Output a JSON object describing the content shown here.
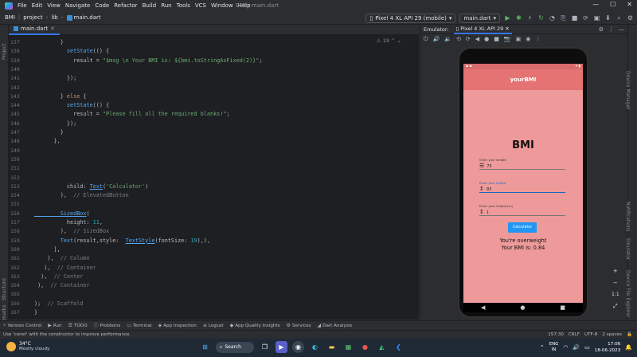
{
  "menubar": {
    "items": [
      "File",
      "Edit",
      "View",
      "Navigate",
      "Code",
      "Refactor",
      "Build",
      "Run",
      "Tools",
      "VCS",
      "Window",
      "Help"
    ],
    "window_title": "BMI - main.dart"
  },
  "navbar": {
    "crumbs": [
      "BMI",
      "project",
      "lib",
      "main.dart"
    ]
  },
  "toolbar": {
    "device": "Pixel 4 XL API 29 (mobile)",
    "run_config": "main.dart"
  },
  "editor": {
    "tab": "main.dart",
    "warnings": "19",
    "lines": [
      {
        "n": "137",
        "t": [
          {
            "c": "cls",
            "v": "        }"
          }
        ]
      },
      {
        "n": "138",
        "t": [
          {
            "c": "fn",
            "v": "          setState"
          },
          {
            "c": "cls",
            "v": "(() {"
          }
        ]
      },
      {
        "n": "139",
        "t": [
          {
            "c": "cls",
            "v": "            result = "
          },
          {
            "c": "str",
            "v": "\"$msg \\n Your BMI is: ${bmi.toStringAsFixed(2)}\""
          },
          {
            "c": "cls",
            "v": ";"
          }
        ]
      },
      {
        "n": "140",
        "t": []
      },
      {
        "n": "141",
        "t": [
          {
            "c": "cls",
            "v": "          });"
          }
        ]
      },
      {
        "n": "142",
        "t": []
      },
      {
        "n": "143",
        "t": [
          {
            "c": "cls",
            "v": "        } "
          },
          {
            "c": "kw",
            "v": "else"
          },
          {
            "c": "cls",
            "v": " {"
          }
        ]
      },
      {
        "n": "144",
        "t": [
          {
            "c": "fn",
            "v": "          setState"
          },
          {
            "c": "cls",
            "v": "(() {"
          }
        ]
      },
      {
        "n": "145",
        "t": [
          {
            "c": "cls",
            "v": "            result = "
          },
          {
            "c": "str",
            "v": "\"Please fill all the required blanks!\""
          },
          {
            "c": "cls",
            "v": ";"
          }
        ]
      },
      {
        "n": "146",
        "t": [
          {
            "c": "cls",
            "v": "          });"
          }
        ]
      },
      {
        "n": "147",
        "t": [
          {
            "c": "cls",
            "v": "        }"
          }
        ]
      },
      {
        "n": "148",
        "t": [
          {
            "c": "cls",
            "v": "      },"
          }
        ]
      },
      {
        "n": "149",
        "t": []
      },
      {
        "n": "150",
        "t": []
      },
      {
        "n": "151",
        "t": []
      },
      {
        "n": "152",
        "t": []
      },
      {
        "n": "153",
        "t": [
          {
            "c": "cls",
            "v": "          child: "
          },
          {
            "c": "lnk",
            "v": "Text"
          },
          {
            "c": "cls",
            "v": "("
          },
          {
            "c": "str",
            "v": "'Calculator'"
          },
          {
            "c": "cls",
            "v": ")"
          }
        ]
      },
      {
        "n": "154",
        "t": [
          {
            "c": "cls",
            "v": "        ),  "
          },
          {
            "c": "cm",
            "v": "// ElevatedButton"
          }
        ]
      },
      {
        "n": "155",
        "t": []
      },
      {
        "n": "156",
        "t": [
          {
            "c": "lnk",
            "v": "        SizedBox"
          },
          {
            "c": "cls",
            "v": "("
          }
        ]
      },
      {
        "n": "157",
        "t": [
          {
            "c": "cls",
            "v": "          height: "
          },
          {
            "c": "num",
            "v": "11"
          },
          {
            "c": "cls",
            "v": ","
          }
        ]
      },
      {
        "n": "158",
        "t": [
          {
            "c": "cls",
            "v": "        ),  "
          },
          {
            "c": "cm",
            "v": "// SizedBox"
          }
        ]
      },
      {
        "n": "159",
        "t": [
          {
            "c": "fn",
            "v": "        Text"
          },
          {
            "c": "cls",
            "v": "(result,style:  "
          },
          {
            "c": "lnk",
            "v": "TextStyle"
          },
          {
            "c": "cls",
            "v": "(fontSize: "
          },
          {
            "c": "num",
            "v": "19"
          },
          {
            "c": "cls",
            "v": "),),"
          }
        ]
      },
      {
        "n": "160",
        "t": [
          {
            "c": "cls",
            "v": "      ],"
          }
        ]
      },
      {
        "n": "161",
        "t": [
          {
            "c": "cls",
            "v": "    ),  "
          },
          {
            "c": "cm",
            "v": "// Column"
          }
        ]
      },
      {
        "n": "162",
        "t": [
          {
            "c": "cls",
            "v": "   ),  "
          },
          {
            "c": "cm",
            "v": "// Container"
          }
        ]
      },
      {
        "n": "163",
        "t": [
          {
            "c": "cls",
            "v": "  ),  "
          },
          {
            "c": "cm",
            "v": "// Center"
          }
        ]
      },
      {
        "n": "164",
        "t": [
          {
            "c": "cls",
            "v": " ),  "
          },
          {
            "c": "cm",
            "v": "// Container"
          }
        ]
      },
      {
        "n": "165",
        "t": []
      },
      {
        "n": "166",
        "t": [
          {
            "c": "cls",
            "v": ");  "
          },
          {
            "c": "cm",
            "v": "// Scaffold"
          }
        ]
      },
      {
        "n": "167",
        "t": [
          {
            "c": "cls",
            "v": "}"
          }
        ]
      }
    ]
  },
  "emulator": {
    "label": "Emulator:",
    "tab": "Pixel 4 XL API 29"
  },
  "app": {
    "appbar_title": "yourBMI",
    "heading": "BMI",
    "weight_label": "Enter your weight",
    "weight_value": "75",
    "height_label": "Enter your height",
    "height_value": "93",
    "hr_label": "Enter your height(cm)",
    "hr_value": "1",
    "button": "Calculator",
    "result_line1": "You're overweight",
    "result_line2": "Your BMI is: 0.84"
  },
  "right_strip": [
    "Device Manager",
    "Notifications",
    "Emulator",
    "Device File Explorer"
  ],
  "left_strip": [
    "Project",
    "Structure",
    "Bookmarks"
  ],
  "bottom_tools": [
    "Version Control",
    "Run",
    "TODO",
    "Problems",
    "Terminal",
    "App Inspection",
    "Logcat",
    "App Quality Insights",
    "Services",
    "Dart Analysis"
  ],
  "statusbar": {
    "message": "Use 'const' with the constructor to improve performance.",
    "right": [
      "157:30",
      "CRLF",
      "UTF-8",
      "2 spaces"
    ]
  },
  "taskbar": {
    "temp": "34°C",
    "cond": "Mostly cloudy",
    "search": "Search",
    "lang1": "ENG",
    "lang2": "IN",
    "time": "17:06",
    "date": "18-06-2023"
  }
}
